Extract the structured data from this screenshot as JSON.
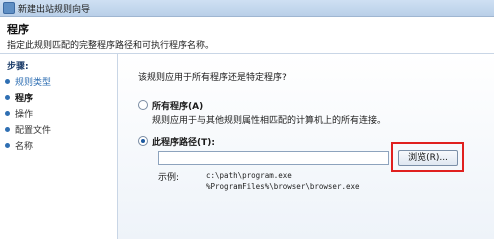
{
  "window": {
    "title": "新建出站规则向导",
    "icon": "firewall-app-icon"
  },
  "header": {
    "title": "程序",
    "description": "指定此规则匹配的完整程序路径和可执行程序名称。"
  },
  "sidebar": {
    "title": "步骤:",
    "items": [
      {
        "label": "规则类型",
        "state": "done"
      },
      {
        "label": "程序",
        "state": "current"
      },
      {
        "label": "操作",
        "state": "todo"
      },
      {
        "label": "配置文件",
        "state": "todo"
      },
      {
        "label": "名称",
        "state": "todo"
      }
    ]
  },
  "main": {
    "question": "该规则应用于所有程序还是特定程序?",
    "all_programs": {
      "label": "所有程序(A)",
      "description": "规则应用于与其他规则属性相匹配的计算机上的所有连接。",
      "selected": false
    },
    "program_path": {
      "label": "此程序路径(T):",
      "value": "",
      "selected": true
    },
    "browse_label": "浏览(R)...",
    "example_label": "示例:",
    "example_lines": [
      "c:\\path\\program.exe",
      "%ProgramFiles%\\browser\\browser.exe"
    ]
  },
  "colors": {
    "highlight": "#e0201f",
    "accent": "#2f6fb3"
  }
}
